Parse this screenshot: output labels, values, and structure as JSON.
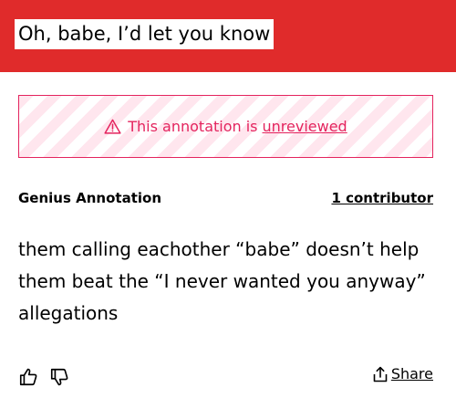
{
  "header": {
    "lyric": "Oh, babe, I’d let you know",
    "background_color": "#e02b2b"
  },
  "banner": {
    "prefix": "This annotation is",
    "link": "unreviewed",
    "icon": "warning-triangle-icon",
    "accent_color": "#e4245e"
  },
  "meta": {
    "source": "Genius Annotation",
    "contributors": "1 contributor"
  },
  "annotation": {
    "text": "them calling eachother “babe” doesn’t help them beat the “I never wanted you anyway” allegations"
  },
  "actions": {
    "upvote_icon": "thumbs-up-icon",
    "downvote_icon": "thumbs-down-icon",
    "share_icon": "share-icon",
    "share_label": "Share"
  }
}
